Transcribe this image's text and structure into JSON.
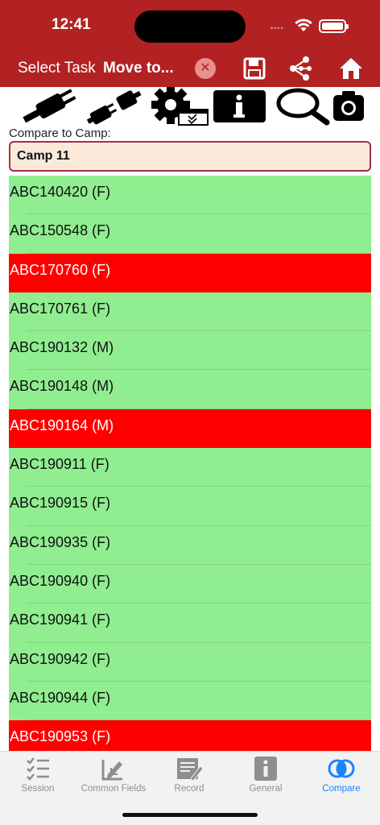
{
  "status_bar": {
    "time": "12:41",
    "signal_dots": "••••"
  },
  "nav": {
    "select_task": "Select Task",
    "current_task": "Move to...",
    "clear_symbol": "✕"
  },
  "compare": {
    "label": "Compare to Camp:",
    "camp_value": "Camp 11"
  },
  "list": {
    "items": [
      {
        "text": "ABC140420 (F)",
        "status": "green"
      },
      {
        "text": "ABC150548 (F)",
        "status": "green"
      },
      {
        "text": "ABC170760 (F)",
        "status": "red"
      },
      {
        "text": "ABC170761 (F)",
        "status": "green"
      },
      {
        "text": "ABC190132 (M)",
        "status": "green"
      },
      {
        "text": "ABC190148 (M)",
        "status": "green"
      },
      {
        "text": "ABC190164 (M)",
        "status": "red"
      },
      {
        "text": "ABC190911 (F)",
        "status": "green"
      },
      {
        "text": "ABC190915 (F)",
        "status": "green"
      },
      {
        "text": "ABC190935 (F)",
        "status": "green"
      },
      {
        "text": "ABC190940 (F)",
        "status": "green"
      },
      {
        "text": "ABC190941 (F)",
        "status": "green"
      },
      {
        "text": "ABC190942 (F)",
        "status": "green"
      },
      {
        "text": "ABC190944 (F)",
        "status": "green"
      },
      {
        "text": "ABC190953 (F)",
        "status": "red"
      }
    ]
  },
  "tabs": [
    {
      "label": "Session",
      "icon": "checklist-icon",
      "active": false
    },
    {
      "label": "Common Fields",
      "icon": "download-edit-icon",
      "active": false
    },
    {
      "label": "Record",
      "icon": "form-pencil-icon",
      "active": false
    },
    {
      "label": "General",
      "icon": "info-icon",
      "active": false
    },
    {
      "label": "Compare",
      "icon": "overlap-circles-icon",
      "active": true
    }
  ],
  "colors": {
    "brand_red": "#b22222",
    "row_green": "#90ee90",
    "row_red": "#ff0000",
    "field_bg": "#fbe9d9",
    "tab_active": "#1a84ff",
    "tab_inactive": "#8e8e8e"
  }
}
